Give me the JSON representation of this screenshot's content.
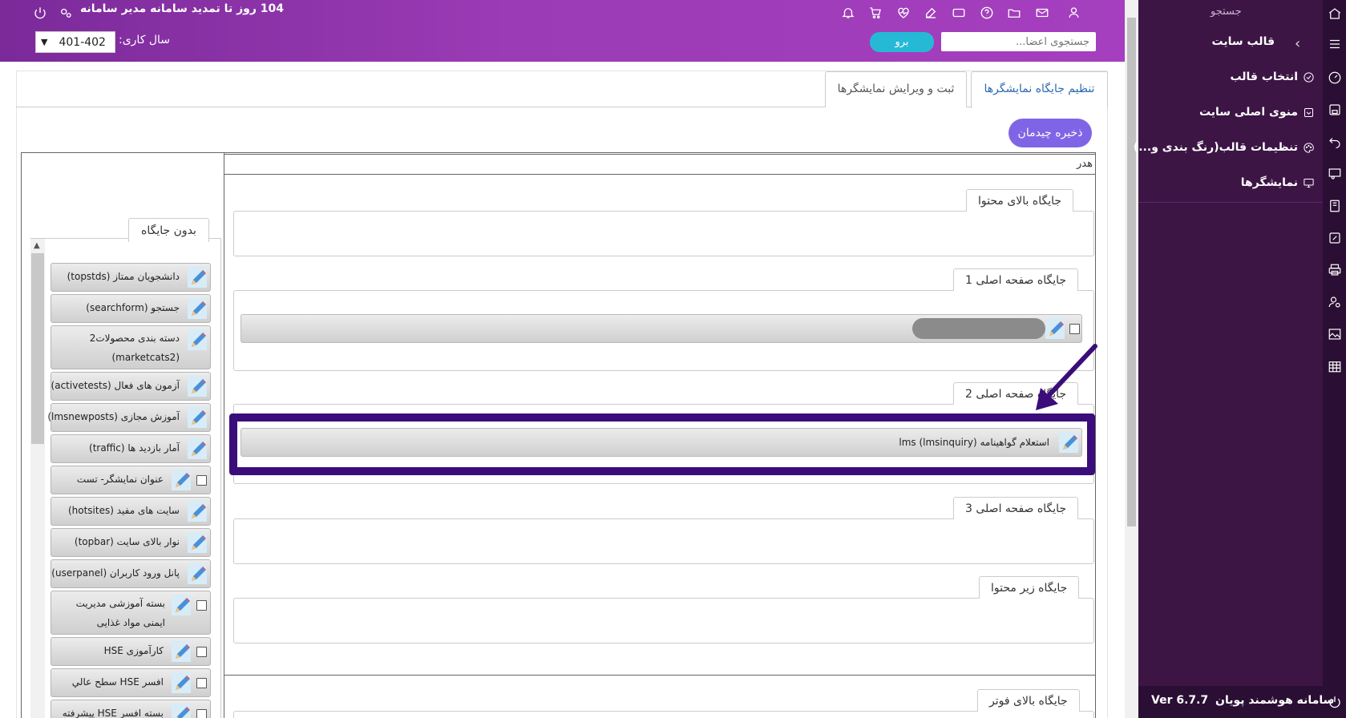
{
  "header": {
    "renewal_text": "104 روز تا تمدید سامانه مدیر سامانه",
    "search_placeholder": "جستجوی اعضا...",
    "go_label": "برو",
    "year_label": "سال کاری:",
    "year_value": "401-402",
    "brand_color": "#9b3bb5"
  },
  "sidebar": {
    "search_label": "جستجو",
    "section_title": "قالب سایت",
    "items": [
      {
        "label": "انتخاب قالب",
        "icon": "check-circle-icon"
      },
      {
        "label": "منوی اصلی سایت",
        "icon": "menu-box-icon"
      },
      {
        "label": "تنظیمات قالب(رنگ بندی و...)",
        "icon": "palette-icon"
      },
      {
        "label": "نمایشگرها",
        "icon": "monitor-icon"
      }
    ],
    "product_name": "سامانه هوشمند پویان",
    "version": "Ver 6.7.7",
    "bg_color": "#3c1545"
  },
  "tabs": {
    "active": "تنظیم جایگاه نمایشگرها",
    "edit": "ثبت و ویرایش نمایشگرها"
  },
  "toolbar": {
    "save_label": "ذخیره چیدمان",
    "save_color": "#7f65e6"
  },
  "board": {
    "header_band": "هدر",
    "zones": {
      "above_content": "جایگاه بالای محتوا",
      "main1": "جایگاه صفحه اصلی 1",
      "main2": "جایگاه صفحه اصلی 2",
      "main3": "جایگاه صفحه اصلی 3",
      "below_content": "جایگاه زیر محتوا",
      "above_footer": "جایگاه بالای فوتر"
    },
    "main2_widget": "استعلام گواهینامه lms (lmsinquiry)",
    "highlight_color": "#3a0d7a"
  },
  "unassigned": {
    "tab_label": "بدون جایگاه",
    "widgets": [
      "دانشجویان ممتاز (topstds)",
      "جستجو (searchform)",
      "دسته بندی محصولات2 (marketcats2)",
      "آزمون های فعال (activetests)",
      "آموزش مجازی (lmsnewposts)",
      "آمار بازدید ها (traffic)",
      "عنوان نمایشگر- تست",
      "سایت های مفید (hotsites)",
      "نوار بالای سایت (topbar)",
      "پانل ورود کاربران (userpanel)",
      "بسته آموزشی مدیریت ایمنی مواد غذایی",
      "کارآموزی HSE",
      "افسر HSE سطح عالي",
      "بسته افسر HSE پیشرفته"
    ]
  }
}
